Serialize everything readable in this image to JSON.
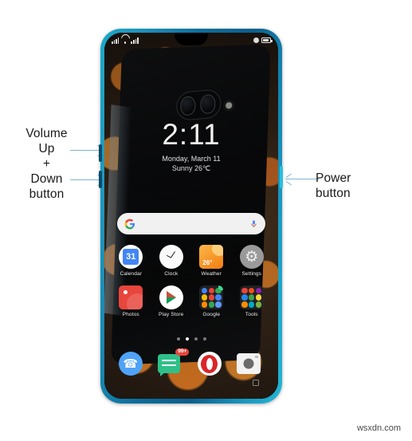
{
  "annotations": {
    "left_label": "Volume\nUp\n+\nDown\nbutton",
    "right_label": "Power\nbutton",
    "arrow_color": "#7fb4cf"
  },
  "watermark": "wsxdn.com",
  "phone": {
    "frame_color": "#0e6f9c",
    "accent_color": "#25b6d4",
    "keys": {
      "volume_up": "volume-up-key",
      "volume_down": "volume-down-key",
      "power": "power-key"
    }
  },
  "screen": {
    "statusbar": {
      "left_icons": [
        "signal-bars-icon",
        "wifi-icon",
        "sim-signal-icon"
      ],
      "right_icons": [
        "alarm-icon",
        "battery-icon"
      ]
    },
    "clock_widget": {
      "time": "2:11",
      "date": "Monday, March 11",
      "weather": "Sunny 26℃"
    },
    "search": {
      "logo": "google-g-icon",
      "mic": "microphone-icon",
      "placeholder": ""
    },
    "app_rows": [
      [
        {
          "label": "Calendar",
          "icon": "calendar-icon",
          "value": "31"
        },
        {
          "label": "Clock",
          "icon": "clock-icon",
          "value": ""
        },
        {
          "label": "Weather",
          "icon": "weather-icon",
          "value": "26°"
        },
        {
          "label": "Settings",
          "icon": "gear-icon",
          "value": ""
        }
      ],
      [
        {
          "label": "Photos",
          "icon": "photos-icon",
          "value": ""
        },
        {
          "label": "Play Store",
          "icon": "play-store-icon",
          "value": ""
        },
        {
          "label": "Google",
          "icon": "folder-icon",
          "value": ""
        },
        {
          "label": "Tools",
          "icon": "folder-icon",
          "value": ""
        }
      ]
    ],
    "page_dots": {
      "count": 4,
      "active_index": 1
    },
    "dock": [
      {
        "label": "Phone",
        "icon": "phone-icon",
        "badge": ""
      },
      {
        "label": "Messages",
        "icon": "message-icon",
        "badge": "99+"
      },
      {
        "label": "Opera",
        "icon": "opera-icon",
        "badge": ""
      },
      {
        "label": "Camera",
        "icon": "camera-icon",
        "badge": ""
      }
    ],
    "nav_hint": "recents-square-icon"
  }
}
